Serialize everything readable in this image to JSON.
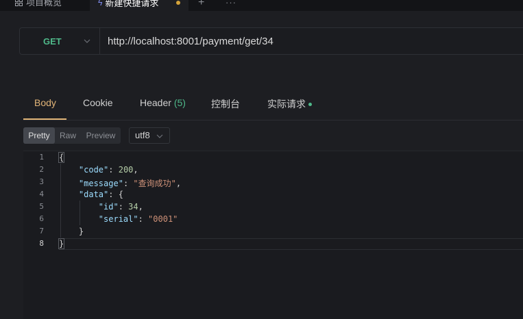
{
  "tabs": {
    "overview_label": "项目概览",
    "active_label": "新建快捷请求",
    "add_symbol": "+",
    "more_symbol": "···"
  },
  "request": {
    "method": "GET",
    "url": "http://localhost:8001/payment/get/34"
  },
  "response_tabs": {
    "body": "Body",
    "cookie": "Cookie",
    "header": "Header",
    "header_count": "(5)",
    "console": "控制台",
    "actual_request": "实际请求"
  },
  "view_modes": {
    "pretty": "Pretty",
    "raw": "Raw",
    "preview": "Preview",
    "selected": "Pretty"
  },
  "encoding": "utf8",
  "editor": {
    "line_numbers": [
      "1",
      "2",
      "3",
      "4",
      "5",
      "6",
      "7",
      "8"
    ],
    "current_line": "8",
    "lines": [
      {
        "indent": "",
        "tokens": [
          {
            "t": "p",
            "v": "{"
          }
        ]
      },
      {
        "indent": "    ",
        "tokens": [
          {
            "t": "k",
            "v": "\"code\""
          },
          {
            "t": "p",
            "v": ": "
          },
          {
            "t": "n",
            "v": "200"
          },
          {
            "t": "p",
            "v": ","
          }
        ]
      },
      {
        "indent": "    ",
        "tokens": [
          {
            "t": "k",
            "v": "\"message\""
          },
          {
            "t": "p",
            "v": ": "
          },
          {
            "t": "s",
            "v": "\"查询成功\""
          },
          {
            "t": "p",
            "v": ","
          }
        ]
      },
      {
        "indent": "    ",
        "tokens": [
          {
            "t": "k",
            "v": "\"data\""
          },
          {
            "t": "p",
            "v": ": {"
          }
        ]
      },
      {
        "indent": "        ",
        "tokens": [
          {
            "t": "k",
            "v": "\"id\""
          },
          {
            "t": "p",
            "v": ": "
          },
          {
            "t": "n",
            "v": "34"
          },
          {
            "t": "p",
            "v": ","
          }
        ]
      },
      {
        "indent": "        ",
        "tokens": [
          {
            "t": "k",
            "v": "\"serial\""
          },
          {
            "t": "p",
            "v": ": "
          },
          {
            "t": "s",
            "v": "\"0001\""
          }
        ]
      },
      {
        "indent": "    ",
        "tokens": [
          {
            "t": "p",
            "v": "}"
          }
        ]
      },
      {
        "indent": "",
        "tokens": [
          {
            "t": "p",
            "v": "}"
          }
        ]
      }
    ]
  },
  "colors": {
    "accent_orange": "#e2b578",
    "method_green": "#4fb98a",
    "json_key": "#9cdcfe",
    "json_string": "#ce9178",
    "json_number": "#b5cea8",
    "unsaved_dot": "#d4a33a"
  },
  "icons": [
    "grid-icon",
    "lightning-icon",
    "unsaved-dot-icon",
    "plus-icon",
    "more-icon",
    "chevron-down-icon"
  ]
}
